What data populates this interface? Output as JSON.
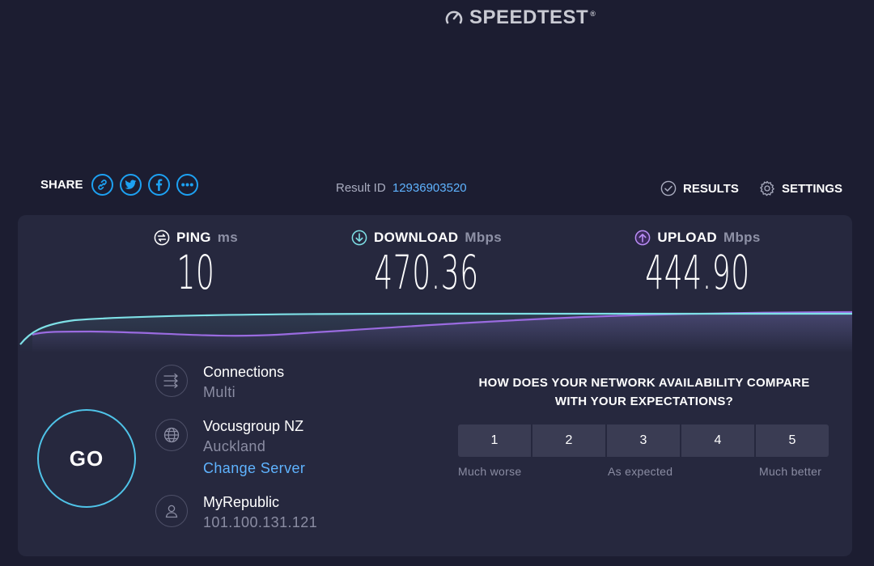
{
  "logo": {
    "text": "SPEEDTEST",
    "icon": "speedometer-icon",
    "reg": "®"
  },
  "share": {
    "label": "SHARE",
    "buttons": [
      "link-icon",
      "twitter-icon",
      "facebook-icon",
      "more-icon"
    ]
  },
  "result": {
    "label": "Result ID",
    "id": "12936903520"
  },
  "nav": {
    "results": "RESULTS",
    "settings": "SETTINGS"
  },
  "metrics": {
    "ping": {
      "label": "PING",
      "unit": "ms",
      "value": "10",
      "icon": "ping-icon"
    },
    "download": {
      "label": "DOWNLOAD",
      "unit": "Mbps",
      "value": "470.36",
      "icon": "download-arrow-icon"
    },
    "upload": {
      "label": "UPLOAD",
      "unit": "Mbps",
      "value": "444.90",
      "icon": "upload-arrow-icon"
    }
  },
  "graph": {
    "download_color": "#7ee0e6",
    "upload_color": "#9a6be0"
  },
  "go": "GO",
  "connections": {
    "title": "Connections",
    "value": "Multi"
  },
  "server": {
    "name": "Vocusgroup NZ",
    "location": "Auckland",
    "change": "Change Server"
  },
  "isp": {
    "name": "MyRepublic",
    "ip": "101.100.131.121"
  },
  "survey": {
    "question_line1": "HOW DOES YOUR NETWORK AVAILABILITY COMPARE",
    "question_line2": "WITH YOUR EXPECTATIONS?",
    "options": [
      "1",
      "2",
      "3",
      "4",
      "5"
    ],
    "label_low": "Much worse",
    "label_mid": "As expected",
    "label_high": "Much better"
  },
  "colors": {
    "background": "#1c1d31",
    "panel": "#26283e",
    "accent": "#5fb3ff",
    "go_ring": "#4fc3e8"
  }
}
